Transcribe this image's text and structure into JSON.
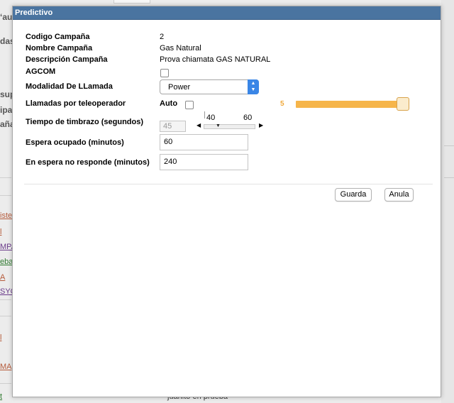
{
  "background": {
    "labels": [
      "ʻau",
      "das",
      "sup",
      "ipa",
      "aña"
    ],
    "links": [
      {
        "text": "iste",
        "color": "#b55a3a"
      },
      {
        "text": "l",
        "color": "#b55a3a"
      },
      {
        "text": "MPA",
        "color": "#6a3a8a"
      },
      {
        "text": "eba",
        "color": "#2f7a2f"
      },
      {
        "text": "A",
        "color": "#b55a3a"
      },
      {
        "text": "SYO",
        "color": "#6a3a8a"
      },
      {
        "text": "l",
        "color": "#b55a3a"
      },
      {
        "text": "MA",
        "color": "#b55a3a"
      },
      {
        "text": "t",
        "color": "#2f7a2f"
      }
    ],
    "footer_text": "juanito en prueba"
  },
  "dialog": {
    "title": "Predictivo",
    "fields": {
      "codigo": {
        "label": "Codigo Campaña",
        "value": "2"
      },
      "nombre": {
        "label": "Nombre Campaña",
        "value": "Gas Natural"
      },
      "descripcion": {
        "label": "Descripción Campaña",
        "value": "Prova chiamata GAS NATURAL"
      },
      "agcom": {
        "label": "AGCOM",
        "checked": false
      },
      "modalidad": {
        "label": "Modalidad De LLamada",
        "selected": "Power"
      },
      "llamadas": {
        "label": "Llamadas por teleoperador",
        "auto_label": "Auto",
        "auto_checked": false,
        "slider_value": "5",
        "slider_fraction": 0.95
      },
      "timbrazo": {
        "label": "Tiempo de timbrazo (segundos)",
        "value": "45",
        "range_min": "40",
        "range_max": "60"
      },
      "espera_ocupado": {
        "label": "Espera ocupado (minutos)",
        "value": "60"
      },
      "espera_no_responde": {
        "label": "En espera no responde (minutos)",
        "value": "240"
      }
    },
    "buttons": {
      "save": "Guarda",
      "cancel": "Anula"
    }
  },
  "colors": {
    "titlebar": "#4a74a0",
    "slider": "#f6b54a",
    "select_arrow": "#3a86e6"
  }
}
